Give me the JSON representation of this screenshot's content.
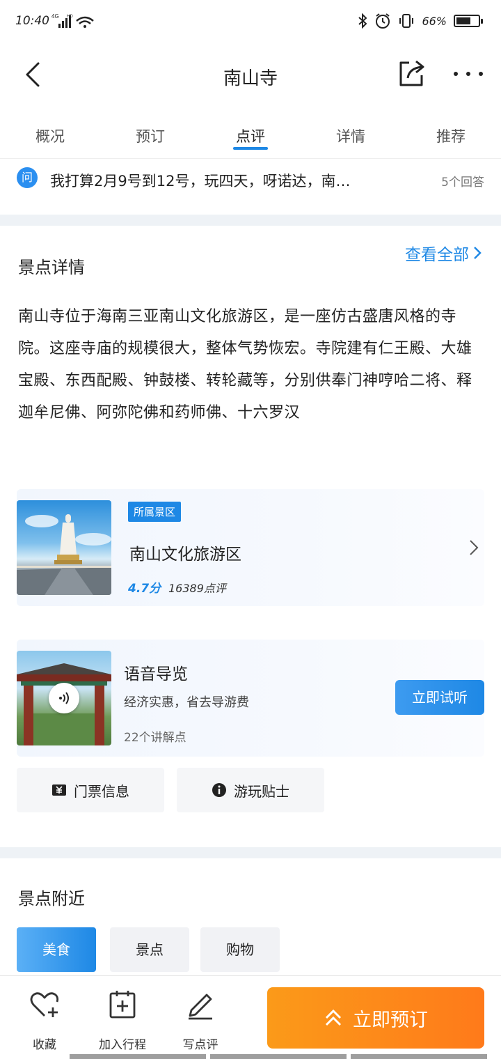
{
  "status": {
    "time": "10:40",
    "network": "4G",
    "hd": "HD",
    "battery": "66%",
    "battery_level": 0.66
  },
  "nav": {
    "title": "南山寺"
  },
  "tabs": [
    {
      "label": "概况"
    },
    {
      "label": "预订"
    },
    {
      "label": "点评",
      "active": true
    },
    {
      "label": "详情"
    },
    {
      "label": "推荐"
    }
  ],
  "qa": {
    "icon": "问",
    "text": "我打算2月9号到12号，玩四天，呀诺达，南…",
    "count": "5个回答"
  },
  "details": {
    "title": "景点详情",
    "see_all": "查看全部",
    "description": "南山寺位于海南三亚南山文化旅游区，是一座仿古盛唐风格的寺院。这座寺庙的规模很大，整体气势恢宏。寺院建有仁王殿、大雄宝殿、东西配殿、钟鼓楼、转轮藏等，分别供奉门神哼哈二将、释迦牟尼佛、阿弥陀佛和药师佛、十六罗汉"
  },
  "scenic_area": {
    "badge": "所属景区",
    "name": "南山文化旅游区",
    "rating": "4.7分",
    "reviews": "16389点评"
  },
  "audio_guide": {
    "title": "语音导览",
    "subtitle": "经济实惠，省去导游费",
    "points": "22个讲解点",
    "button": "立即试听"
  },
  "info_buttons": {
    "tickets": "门票信息",
    "tips": "游玩贴士"
  },
  "nearby": {
    "title": "景点附近",
    "categories": [
      {
        "label": "美食",
        "active": true
      },
      {
        "label": "景点"
      },
      {
        "label": "购物"
      }
    ]
  },
  "bottom": {
    "favorite": "收藏",
    "add_trip": "加入行程",
    "write_review": "写点评",
    "book": "立即预订"
  },
  "colors": {
    "accent": "#1e88e5",
    "book_orange": "#ff8a1a",
    "divider": "#eef2f6"
  }
}
